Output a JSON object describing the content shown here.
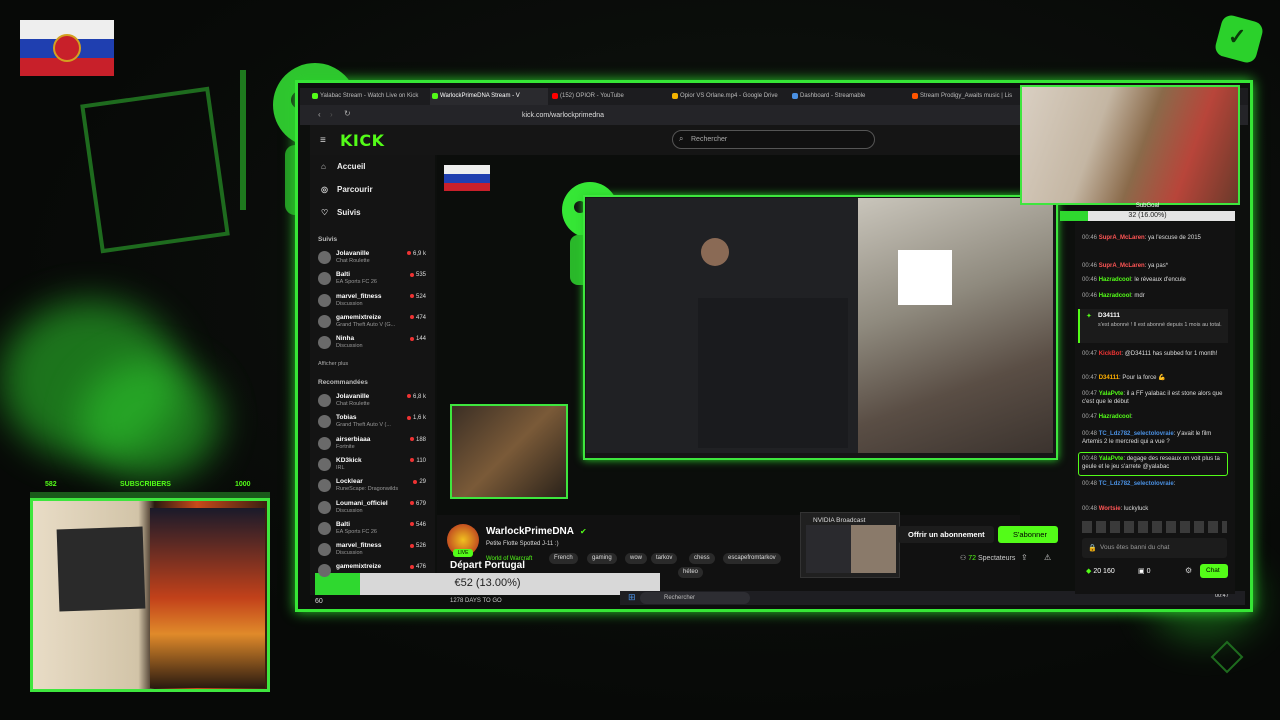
{
  "browser": {
    "tabs": [
      {
        "label": "Yalabac Stream - Watch Live on Kick",
        "color": "#53fc18"
      },
      {
        "label": "WarlockPrimeDNA Stream - V",
        "color": "#53fc18",
        "active": true
      },
      {
        "label": "(152) OPIOR - YouTube",
        "color": "#ff0000"
      },
      {
        "label": "Opior VS Orlane.mp4 - Google Drive",
        "color": "#f4b400"
      },
      {
        "label": "Dashboard - Streamable",
        "color": "#4a90e2"
      },
      {
        "label": "Stream Prodigy_Awaits music | Lis",
        "color": "#ff5500"
      }
    ],
    "url": "kick.com/warlockprimedna"
  },
  "kick": {
    "logo": "KICK",
    "search_placeholder": "Rechercher",
    "nav": {
      "home": "Accueil",
      "browse": "Parcourir",
      "following": "Suivis"
    },
    "followed_header": "Suivis",
    "followed": [
      {
        "name": "Jolavanille",
        "category": "Chat Roulette",
        "viewers": "6,9 k"
      },
      {
        "name": "Balti",
        "category": "EA Sports FC 26",
        "viewers": "535"
      },
      {
        "name": "marvel_fitness",
        "category": "Discussion",
        "viewers": "524"
      },
      {
        "name": "gamemixtreize",
        "category": "Grand Theft Auto V (G...",
        "viewers": "474"
      },
      {
        "name": "Ninha",
        "category": "Discussion",
        "viewers": "144"
      }
    ],
    "show_more": "Afficher plus",
    "recommended_header": "Recommandées",
    "recommended": [
      {
        "name": "Jolavanille",
        "category": "Chat Roulette",
        "viewers": "6,8 k"
      },
      {
        "name": "Tobias",
        "category": "Grand Theft Auto V (...",
        "viewers": "1,6 k"
      },
      {
        "name": "airserbiaaa",
        "category": "Fortnite",
        "viewers": "188"
      },
      {
        "name": "KD3kick",
        "category": "IRL",
        "viewers": "110"
      },
      {
        "name": "Locklear",
        "category": "RuneScape: Dragonwilds",
        "viewers": "29"
      },
      {
        "name": "Loumani_officiel",
        "category": "Discussion",
        "viewers": "679"
      },
      {
        "name": "Balti",
        "category": "EA Sports FC 26",
        "viewers": "546"
      },
      {
        "name": "marvel_fitness",
        "category": "Discussion",
        "viewers": "526"
      },
      {
        "name": "gamemixtreize",
        "category": "",
        "viewers": "476"
      }
    ],
    "stream": {
      "name": "WarlockPrimeDNA",
      "title": "Petite Flotte Spotted J-11 :)",
      "game": "World of Warcraft",
      "tags": [
        "French",
        "gaming",
        "wow",
        "tarkov",
        "chess",
        "escapefromtarkov",
        "héteo"
      ],
      "live_badge": "LIVE",
      "subscribe_offer": "Offrir un abonnement",
      "subscribe": "S'abonner",
      "spectators_count": "72",
      "spectators_label": "Spectateurs"
    },
    "chat": {
      "messages": [
        {
          "time": "00:46",
          "user": "SuprA_McLaren",
          "color": "#ff5555",
          "text": "ya l'escuse de 2015"
        },
        {
          "time": "00:46",
          "user": "SuprA_McLaren",
          "color": "#ff5555",
          "text": "ya pas*"
        },
        {
          "time": "00:46",
          "user": "Hazradcool",
          "color": "#53fc18",
          "text": "le réveaux d'encule"
        },
        {
          "time": "00:46",
          "user": "Hazradcool",
          "color": "#53fc18",
          "text": "mdr"
        },
        {
          "time": "00:47",
          "user": "KickBot",
          "color": "#e33",
          "text": "@D34111 has subbed for 1 month!"
        },
        {
          "time": "00:47",
          "user": "D34111",
          "color": "#ffb000",
          "text": "Pour la force 💪"
        },
        {
          "time": "00:47",
          "user": "YalaPvte",
          "color": "#53fc18",
          "text": "il a FF yalabac il est stone alors que c'est que le début"
        },
        {
          "time": "00:47",
          "user": "Hazradcool",
          "color": "#53fc18",
          "text": ""
        },
        {
          "time": "00:48",
          "user": "TC_Ldz782_selectolovraie",
          "color": "#4a90e2",
          "text": "y'avait le film Artemis 2 le mercredi qui a vue ?"
        },
        {
          "time": "00:48",
          "user": "YalaPvte",
          "color": "#53fc18",
          "text": "degage des reseaux on voit plus ta geule et le jeu s'arrete @yalabac"
        },
        {
          "time": "00:48",
          "user": "TC_Ldz782_selectolovraie",
          "color": "#4a90e2",
          "text": ""
        },
        {
          "time": "00:48",
          "user": "Wortsie",
          "color": "#ff5555",
          "text": "luckyluck"
        }
      ],
      "sub_event": {
        "user": "D34111",
        "text": "s'est abonné ! Il est abonné depuis 1 mois au total."
      },
      "banned": "Vous êtes banni du chat",
      "points": "20 160",
      "points2": "0",
      "chat_button": "Chat"
    }
  },
  "overlay": {
    "goal_text": "€52 (13.00%)",
    "goal_fraction": 0.13,
    "depart": "Départ Portugal",
    "days_to_go": "1278 DAYS TO GO",
    "subgoal_label": "SubGoal",
    "subgoal_text": "32 (16.00%)",
    "subgoal_fraction": 0.16,
    "subs_current": "582",
    "subs_label": "SUBSCRIBERS",
    "subs_goal": "1000",
    "sixty": "60"
  },
  "taskbar": {
    "search": "Rechercher",
    "nvidia": "NVIDIA Broadcast",
    "time": "00:47"
  },
  "colors": {
    "accent": "#53fc18",
    "frame": "#36e636"
  }
}
